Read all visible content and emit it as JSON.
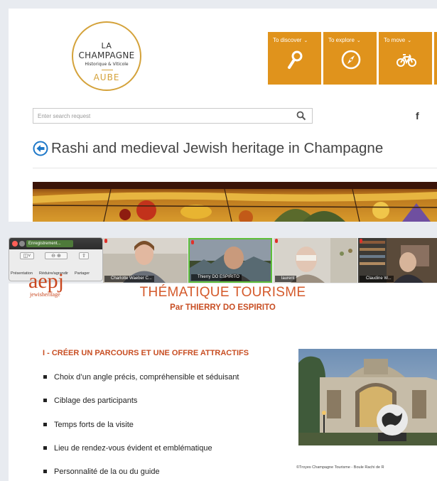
{
  "website": {
    "logo": {
      "line1": "LA",
      "line2": "CHAMPAGNE",
      "line3": "Historique & Viticole",
      "line4": "AUBE"
    },
    "nav": [
      {
        "label": "To discover",
        "icon": "magnifier-icon"
      },
      {
        "label": "To explore",
        "icon": "compass-icon"
      },
      {
        "label": "To move",
        "icon": "bicycle-icon"
      }
    ],
    "search": {
      "placeholder": "Enter search request",
      "value": ""
    },
    "facebook": "f",
    "page_title": "Rashi and medieval Jewish heritage in Champagne",
    "accent_color": "#e0931c"
  },
  "call": {
    "recorder": {
      "window_title": "Enregistrement...",
      "tools": [
        "Présentation",
        "Réduire/agrandir",
        "Partager"
      ]
    },
    "participants": [
      {
        "name": "Charlotte Waeber C..."
      },
      {
        "name": "Thierry DO ESPIRITO"
      },
      {
        "name": "laurent"
      },
      {
        "name": "Claudine W..."
      }
    ]
  },
  "slide": {
    "brand": {
      "name": "aepj",
      "tagline": "jewisheritage"
    },
    "title": "THÉMATIQUE TOURISME",
    "subtitle": "Par THIERRY DO ESPIRITO",
    "section": "I - CRÉER UN PARCOURS ET UNE OFFRE ATTRACTIFS",
    "bullets": [
      "Choix d’un angle précis, compréhensible et séduisant",
      "Ciblage des participants",
      "Temps forts de la visite",
      "Lieu de rendez-vous évident et emblématique",
      "Personnalité de la ou du guide"
    ],
    "photo_credit": "©Troyes Champagne Tourisme -  Boule Rachi de R",
    "accent_color": "#c84e23"
  }
}
